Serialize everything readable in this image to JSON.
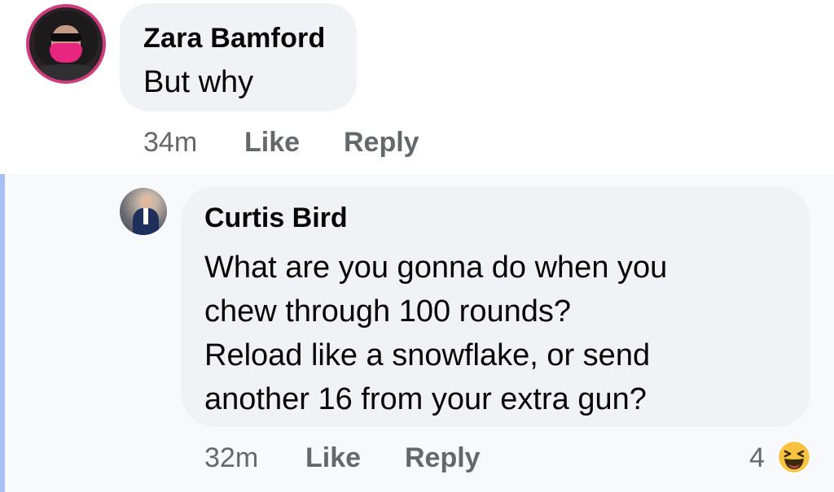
{
  "comments": [
    {
      "author": "Zara Bamford",
      "text": "But why",
      "time": "34m",
      "like_label": "Like",
      "reply_label": "Reply"
    }
  ],
  "reply": {
    "author": "Curtis Bird",
    "text_lines": [
      "What are you gonna do when you",
      "chew through 100 rounds?",
      "Reload like a snowflake, or send",
      "another 16 from your extra gun?"
    ],
    "time": "32m",
    "like_label": "Like",
    "reply_label": "Reply",
    "reaction_count": "4",
    "reaction_icon": "haha-emoji-icon"
  },
  "colors": {
    "bubble": "#f0f2f5",
    "meta_text": "#65676b",
    "thread_line": "#a7bff2",
    "thread_bg": "#f7f9fc",
    "haha_yellow": "#f7c341"
  }
}
